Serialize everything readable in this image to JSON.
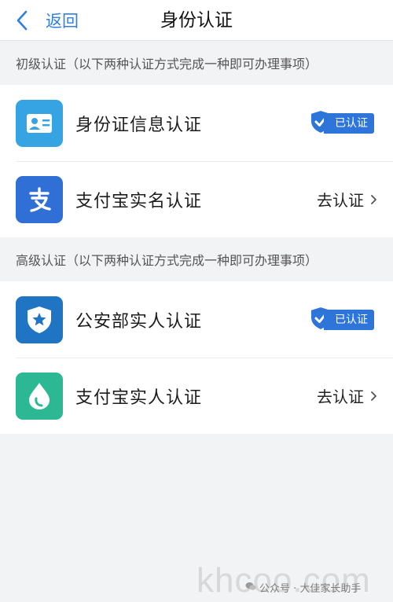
{
  "navbar": {
    "back_label": "返回",
    "title": "身份认证"
  },
  "basic": {
    "heading": "初级认证（以下两种认证方式完成一种即可办理事项）",
    "items": [
      {
        "label": "身份证信息认证",
        "icon": "id-card-icon",
        "status": "已认证",
        "verified": true
      },
      {
        "label": "支付宝实名认证",
        "icon": "alipay-icon",
        "status": "去认证",
        "verified": false
      }
    ]
  },
  "advanced": {
    "heading": "高级认证（以下两种认证方式完成一种即可办理事项）",
    "items": [
      {
        "label": "公安部实人认证",
        "icon": "police-shield-icon",
        "status": "已认证",
        "verified": true
      },
      {
        "label": "支付宝实人认证",
        "icon": "face-drop-icon",
        "status": "去认证",
        "verified": false
      }
    ]
  },
  "colors": {
    "accent": "#2d75d8",
    "background": "#f2f3f5"
  },
  "watermark": {
    "text": "khcoo.com",
    "caption": "公众号 · 大佳家长助手"
  }
}
